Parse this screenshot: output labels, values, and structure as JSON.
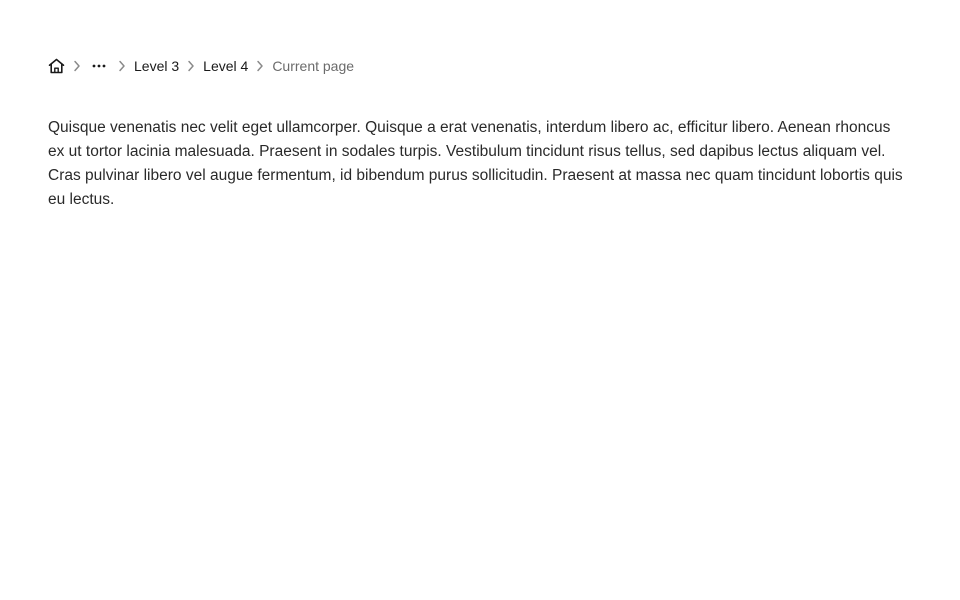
{
  "breadcrumb": {
    "home_icon": "home-icon",
    "ellipsis_icon": "more-horizontal-icon",
    "separator_icon": "chevron-right-icon",
    "items": [
      {
        "label": "Level 3"
      },
      {
        "label": "Level 4"
      }
    ],
    "current": "Current page"
  },
  "content": {
    "paragraph": "Quisque venenatis nec velit eget ullamcorper. Quisque a erat venenatis, interdum libero ac, efficitur libero. Aenean rhoncus ex ut tortor lacinia malesuada. Praesent in sodales turpis. Vestibulum tincidunt risus tellus, sed dapibus lectus aliquam vel. Cras pulvinar libero vel augue fermentum, id bibendum purus sollicitudin. Praesent at massa nec quam tincidunt lobortis quis eu lectus."
  },
  "colors": {
    "link": "#1a1a1a",
    "current": "#6b6b6b",
    "separator": "#8a8a8a"
  }
}
